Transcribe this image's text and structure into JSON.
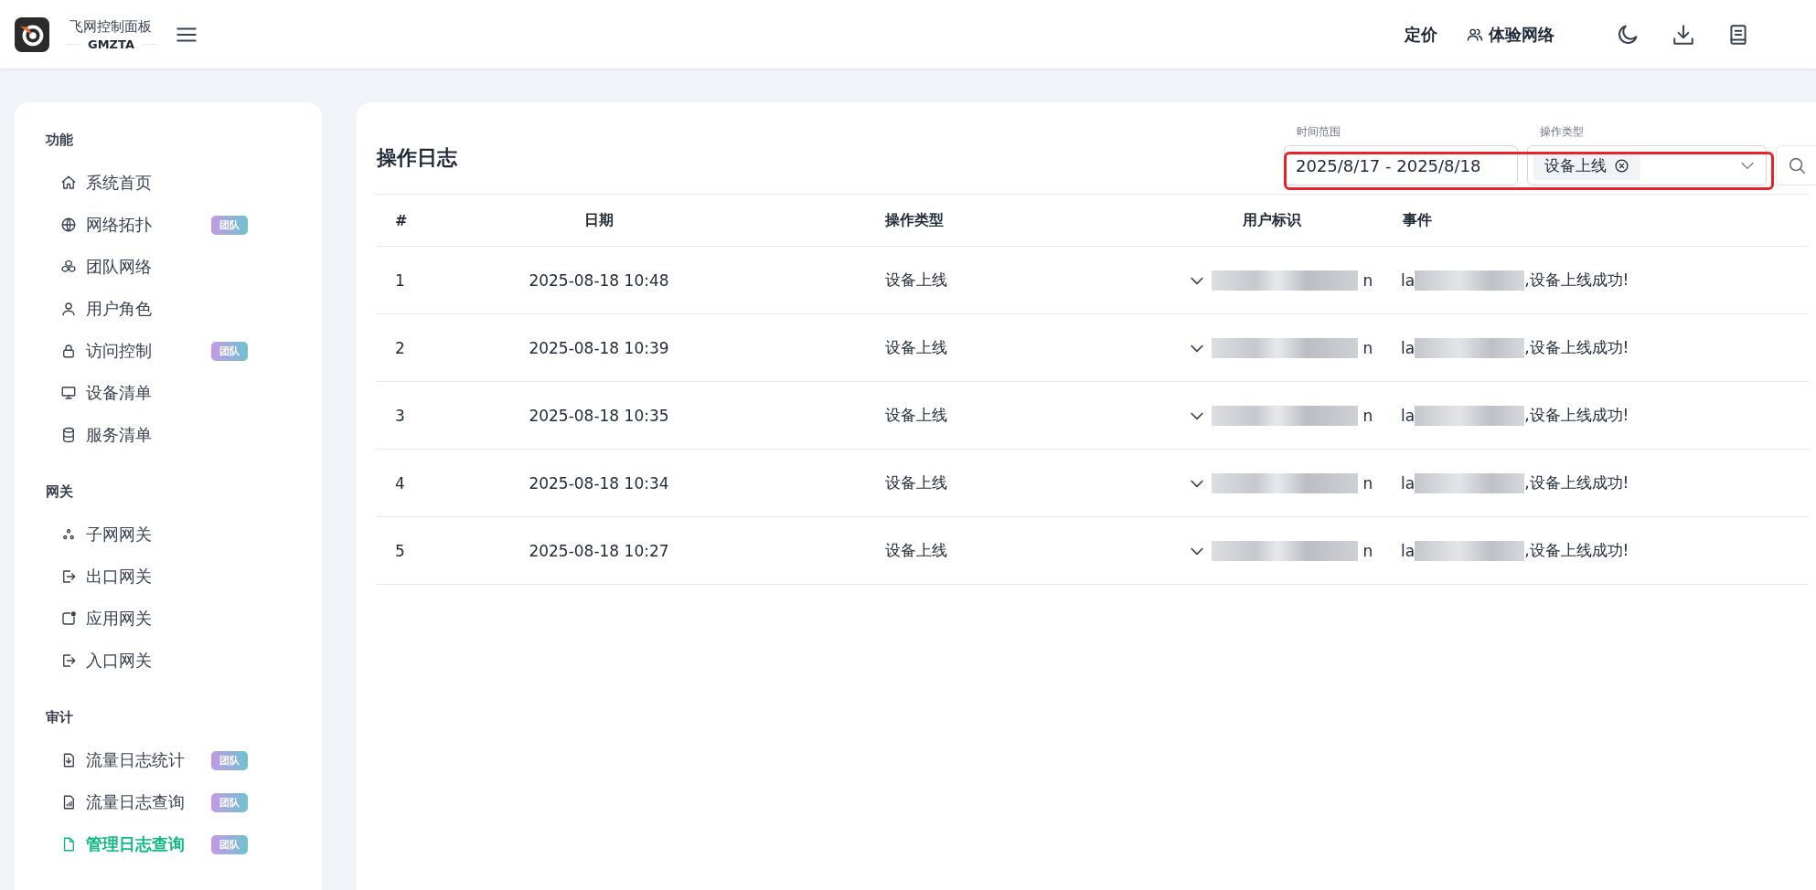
{
  "header": {
    "title": "飞网控制面板",
    "subtitle": "GMZTA",
    "links": [
      {
        "label": "定价",
        "kind": "text"
      },
      {
        "label": "体验网络",
        "kind": "user"
      }
    ]
  },
  "sidebar": {
    "groups": [
      {
        "label": "功能",
        "items": [
          {
            "label": "系统首页",
            "selected": false
          },
          {
            "label": "网络拓扑",
            "badge": "团队",
            "selected": false
          },
          {
            "label": "团队网络",
            "selected": false
          },
          {
            "label": "用户角色",
            "selected": false
          },
          {
            "label": "访问控制",
            "badge": "团队",
            "selected": false
          },
          {
            "label": "设备清单",
            "selected": false
          },
          {
            "label": "服务清单",
            "selected": false
          }
        ]
      },
      {
        "label": "网关",
        "items": [
          {
            "label": "子网网关",
            "selected": false
          },
          {
            "label": "出口网关",
            "selected": false
          },
          {
            "label": "应用网关",
            "selected": false
          },
          {
            "label": "入口网关",
            "selected": false
          }
        ]
      },
      {
        "label": "审计",
        "items": [
          {
            "label": "流量日志统计",
            "badge": "团队",
            "selected": false
          },
          {
            "label": "流量日志查询",
            "badge": "团队",
            "selected": false
          },
          {
            "label": "管理日志查询",
            "badge": "团队",
            "selected": true
          }
        ]
      }
    ]
  },
  "main": {
    "title": "操作日志",
    "filters": {
      "time_range": {
        "label": "时间范围",
        "value": "2025/8/17 - 2025/8/18"
      },
      "operation_type": {
        "label": "操作类型",
        "tags": [
          "设备上线"
        ]
      }
    },
    "table": {
      "columns": [
        "#",
        "日期",
        "操作类型",
        "用户标识",
        "事件"
      ],
      "rows": [
        {
          "index": "1",
          "date": "2025-08-18 10:48",
          "type": "设备上线",
          "user_tail": "n",
          "event_head": "la",
          "event_tail": ",设备上线成功!"
        },
        {
          "index": "2",
          "date": "2025-08-18 10:39",
          "type": "设备上线",
          "user_tail": "n",
          "event_head": "la",
          "event_tail": ",设备上线成功!"
        },
        {
          "index": "3",
          "date": "2025-08-18 10:35",
          "type": "设备上线",
          "user_tail": "n",
          "event_head": "la",
          "event_tail": ",设备上线成功!"
        },
        {
          "index": "4",
          "date": "2025-08-18 10:34",
          "type": "设备上线",
          "user_tail": "n",
          "event_head": "la",
          "event_tail": ",设备上线成功!"
        },
        {
          "index": "5",
          "date": "2025-08-18 10:27",
          "type": "设备上线",
          "user_tail": "n",
          "event_head": "la",
          "event_tail": ",设备上线成功!"
        }
      ]
    }
  }
}
